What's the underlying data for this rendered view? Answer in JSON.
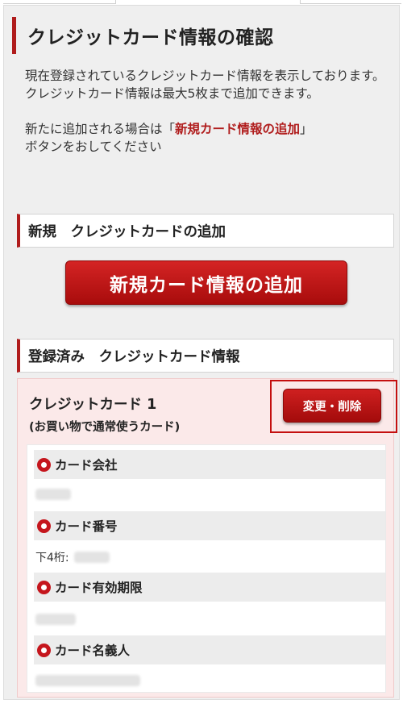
{
  "page": {
    "title": "クレジットカード情報の確認",
    "intro": [
      "現在登録されているクレジットカード情報を表示しております。",
      "クレジットカード情報は最大5枚まで追加できます。"
    ],
    "add_note_prefix": "新たに追加される場合は「",
    "add_note_highlight": "新規カード情報の追加",
    "add_note_suffix": "」",
    "add_note_line2": "ボタンをおしてください"
  },
  "sections": {
    "new_heading": "新規　クレジットカードの追加",
    "add_button": "新規カード情報の追加",
    "registered_heading": "登録済み　クレジットカード情報"
  },
  "card": {
    "title": "クレジットカード 1",
    "subtitle": "(お買い物で通常使うカード)",
    "edit_button": "変更・削除",
    "fields": [
      {
        "label": "カード会社",
        "icon": "bullet-icon"
      },
      {
        "label": "カード番号",
        "icon": "bullet-icon",
        "value_prefix": "下4桁:"
      },
      {
        "label": "カード有効期限",
        "icon": "bullet-icon"
      },
      {
        "label": "カード名義人",
        "icon": "bullet-icon"
      }
    ]
  },
  "colors": {
    "accent": "#b01c1c",
    "button": "#c01818",
    "card_bg": "#fbe9e9",
    "field_bg": "#ececec",
    "page_bg": "#efefef"
  }
}
